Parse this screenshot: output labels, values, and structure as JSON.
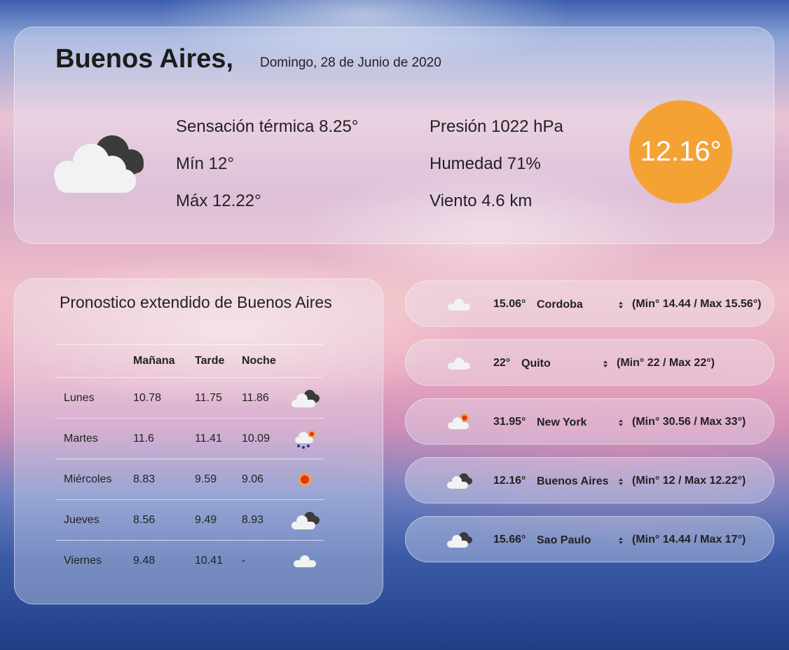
{
  "current": {
    "city": "Buenos Aires,",
    "date": "Domingo, 28 de Junio de 2020",
    "icon": "dark-clouds-icon",
    "feels_like": "Sensación térmica 8.25°",
    "min": "Mín 12°",
    "max": "Máx 12.22°",
    "pressure": "Presión 1022 hPa",
    "humidity": "Humedad 71%",
    "wind": "Viento 4.6 km",
    "temp": "12.16°",
    "accent_color": "#f5a235"
  },
  "forecast": {
    "title": "Pronostico extendido de Buenos Aires",
    "headers": [
      "",
      "Mañana",
      "Tarde",
      "Noche",
      ""
    ],
    "rows": [
      {
        "day": "Lunes",
        "morning": "10.78",
        "afternoon": "11.75",
        "night": "11.86",
        "icon": "dark-clouds-icon"
      },
      {
        "day": "Martes",
        "morning": "11.6",
        "afternoon": "11.41",
        "night": "10.09",
        "icon": "rain-sun-icon"
      },
      {
        "day": "Miércoles",
        "morning": "8.83",
        "afternoon": "9.59",
        "night": "9.06",
        "icon": "sun-icon"
      },
      {
        "day": "Jueves",
        "morning": "8.56",
        "afternoon": "9.49",
        "night": "8.93",
        "icon": "dark-clouds-icon"
      },
      {
        "day": "Viernes",
        "morning": "9.48",
        "afternoon": "10.41",
        "night": "-",
        "icon": "cloud-icon"
      }
    ]
  },
  "cities": [
    {
      "temp": "15.06°",
      "name": "Cordoba",
      "range": "(Min° 14.44 / Max 15.56°)",
      "icon": "cloud-icon"
    },
    {
      "temp": "22°",
      "name": "Quito",
      "range": "(Min° 22 / Max 22°)",
      "icon": "cloud-icon"
    },
    {
      "temp": "31.95°",
      "name": "New York",
      "range": "(Min° 30.56 / Max 33°)",
      "icon": "sun-cloud-icon"
    },
    {
      "temp": "12.16°",
      "name": "Buenos Aires",
      "range": "(Min° 12 / Max 12.22°)",
      "icon": "dark-clouds-icon"
    },
    {
      "temp": "15.66°",
      "name": "Sao Paulo",
      "range": "(Min° 14.44 / Max 17°)",
      "icon": "dark-clouds-icon"
    }
  ]
}
